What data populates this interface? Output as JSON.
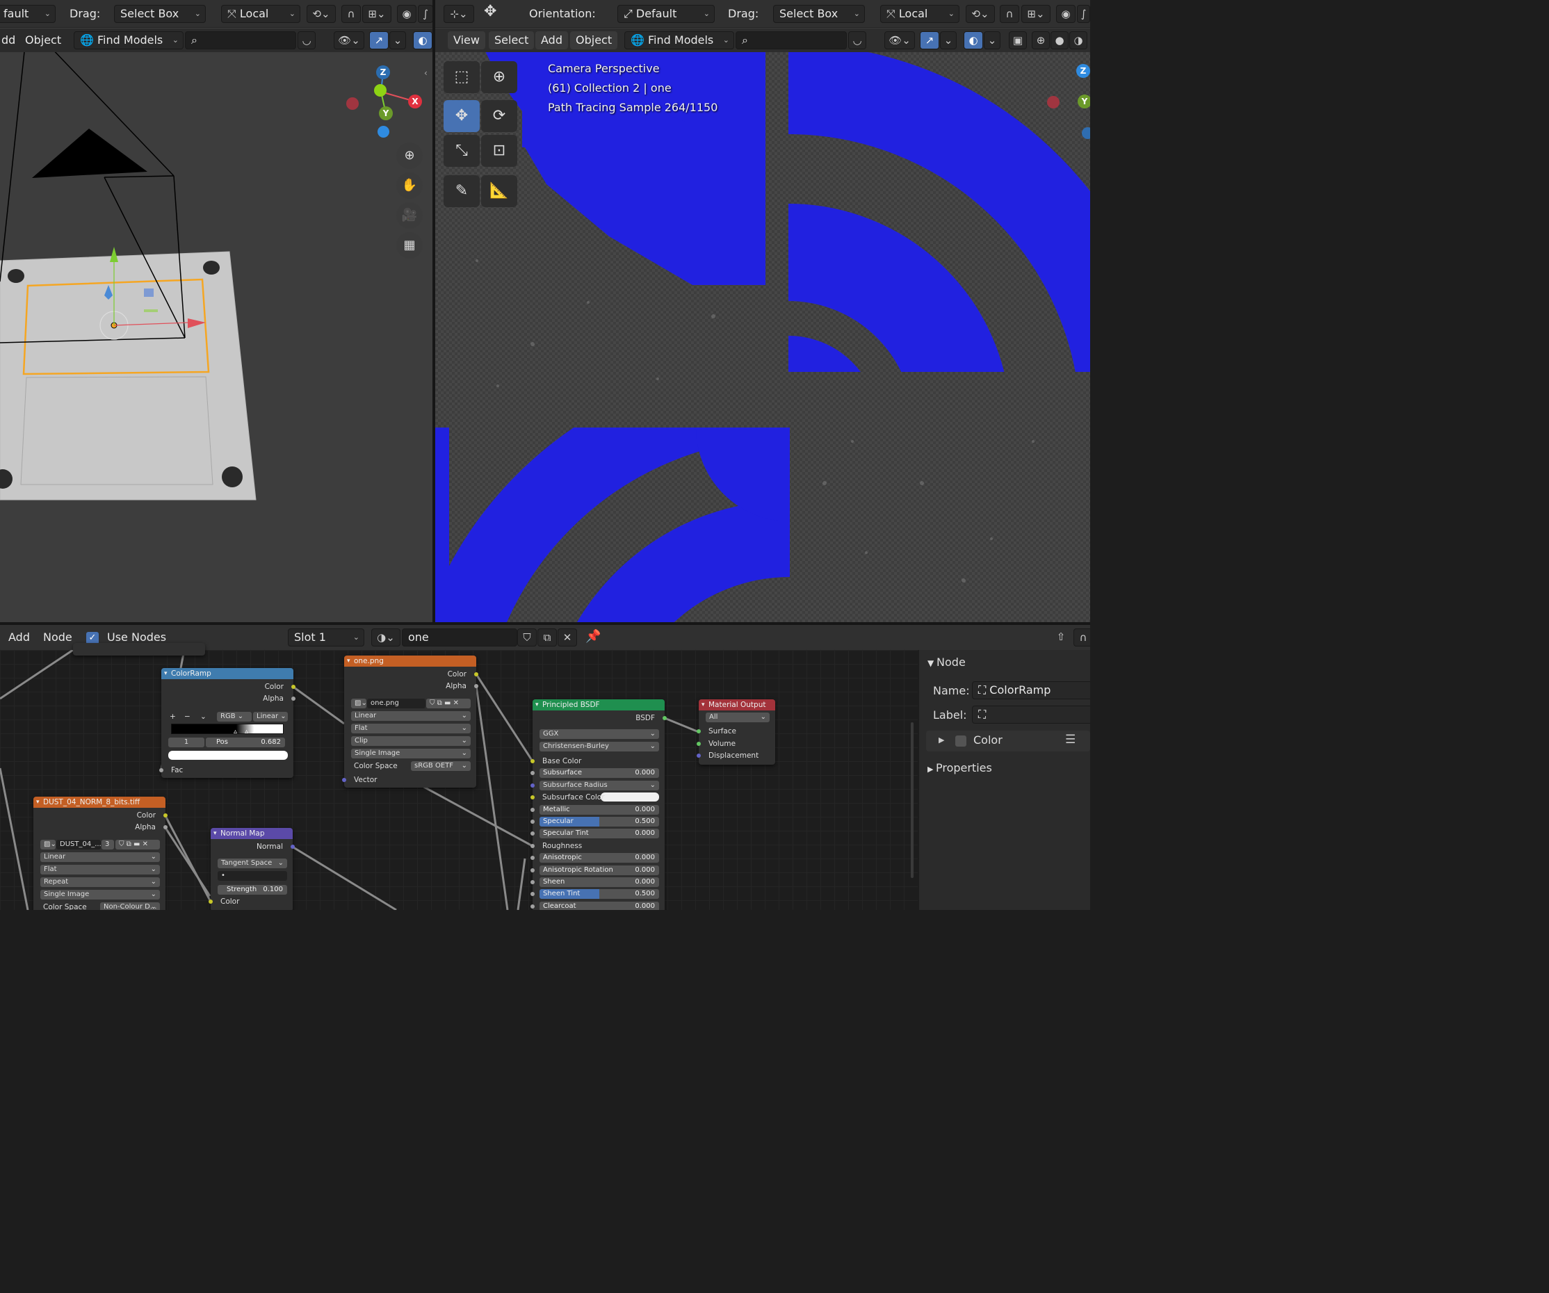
{
  "left_header": {
    "mode_partial": "fault",
    "drag_label": "Drag:",
    "drag_value": "Select Box",
    "transform_value": "Local"
  },
  "left_menu": {
    "add_partial": "dd",
    "object": "Object",
    "find_models": "Find Models",
    "search_placeholder": ""
  },
  "right_header": {
    "orientation_label": "Orientation:",
    "orientation_value": "Default",
    "drag_label": "Drag:",
    "drag_value": "Select Box",
    "transform_value": "Local"
  },
  "right_menu": {
    "view": "View",
    "select": "Select",
    "add": "Add",
    "object": "Object",
    "find_models": "Find Models"
  },
  "viewport_overlay": {
    "line1": "Camera Perspective",
    "line2": "(61) Collection 2 | one",
    "line3": "Path Tracing Sample 264/1150"
  },
  "gizmo": {
    "x": "X",
    "y": "Y",
    "z": "Z"
  },
  "node_header": {
    "add": "Add",
    "node": "Node",
    "use_nodes": "Use Nodes",
    "slot": "Slot 1",
    "material": "one"
  },
  "nodes": {
    "colorramp": {
      "title": "ColorRamp",
      "out_color": "Color",
      "out_alpha": "Alpha",
      "mode": "RGB",
      "interp": "Linear",
      "index": "1",
      "pos_label": "Pos",
      "pos_value": "0.682",
      "in_fac": "Fac"
    },
    "image1": {
      "title": "one.png",
      "out_color": "Color",
      "out_alpha": "Alpha",
      "image_name": "one.png",
      "interp": "Linear",
      "proj": "Flat",
      "ext": "Clip",
      "source": "Single Image",
      "cs_label": "Color Space",
      "cs_value": "sRGB OETF",
      "in_vector": "Vector"
    },
    "bsdf": {
      "title": "Principled BSDF",
      "out": "BSDF",
      "dist": "GGX",
      "sss_method": "Christensen-Burley",
      "inputs": [
        {
          "label": "Base Color",
          "value": ""
        },
        {
          "label": "Subsurface",
          "value": "0.000"
        },
        {
          "label": "Subsurface Radius",
          "value": ""
        },
        {
          "label": "Subsurface Color",
          "value": ""
        },
        {
          "label": "Metallic",
          "value": "0.000"
        },
        {
          "label": "Specular",
          "value": "0.500"
        },
        {
          "label": "Specular Tint",
          "value": "0.000"
        },
        {
          "label": "Roughness",
          "value": ""
        },
        {
          "label": "Anisotropic",
          "value": "0.000"
        },
        {
          "label": "Anisotropic Rotation",
          "value": "0.000"
        },
        {
          "label": "Sheen",
          "value": "0.000"
        },
        {
          "label": "Sheen Tint",
          "value": "0.500"
        },
        {
          "label": "Clearcoat",
          "value": "0.000"
        }
      ]
    },
    "output": {
      "title": "Material Output",
      "target": "All",
      "in_surface": "Surface",
      "in_volume": "Volume",
      "in_disp": "Displacement"
    },
    "image2": {
      "title": "DUST_04_NORM_8_bits.tiff",
      "out_color": "Color",
      "out_alpha": "Alpha",
      "image_name": "DUST_04_...",
      "users": "3",
      "interp": "Linear",
      "proj": "Flat",
      "ext": "Repeat",
      "source": "Single Image",
      "cs_label": "Color Space",
      "cs_value": "Non-Colour D..."
    },
    "normalmap": {
      "title": "Normal Map",
      "out": "Normal",
      "space": "Tangent Space",
      "strength_label": "Strength",
      "strength_value": "0.100",
      "in_color": "Color"
    }
  },
  "sidebar": {
    "node_panel": "Node",
    "name_label": "Name:",
    "name_value": "ColorRamp",
    "label_label": "Label:",
    "label_value": "",
    "color_sub": "Color",
    "properties": "Properties"
  },
  "colors": {
    "accent": "#4772b3",
    "render_blue": "#2121e0",
    "shader_header": "#1f8f4f",
    "output_header": "#a3323a",
    "image_header": "#c45f24",
    "converter_header": "#3f7cae",
    "vector_header": "#5b4aa8",
    "selection_orange": "#f5a623"
  }
}
